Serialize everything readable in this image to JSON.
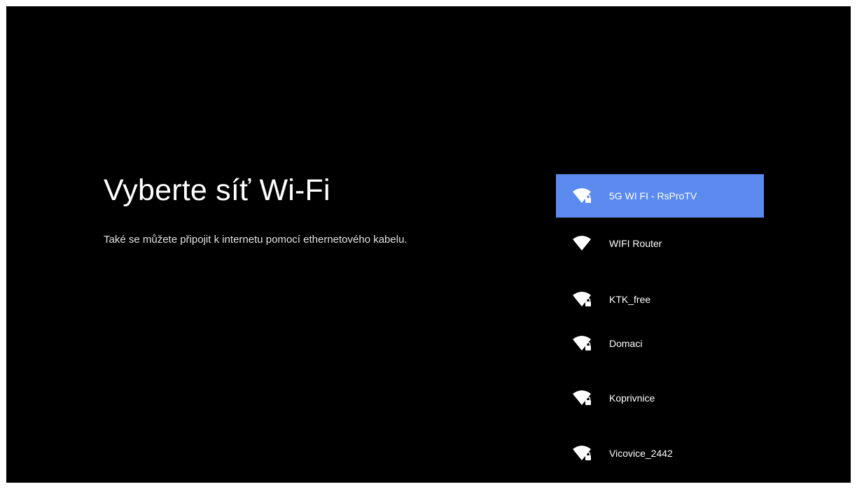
{
  "page": {
    "title": "Vyberte síť Wi-Fi",
    "subtitle": "Také se můžete připojit k internetu pomocí ethernetového kabelu."
  },
  "networks": [
    {
      "name": "5G WI FI - RsProTV",
      "selected": true,
      "secured": true,
      "icon": "wifi-lock-icon"
    },
    {
      "name": "WIFI Router",
      "selected": false,
      "secured": false,
      "icon": "wifi-icon"
    },
    {
      "name": "KTK_free",
      "selected": false,
      "secured": true,
      "icon": "wifi-lock-icon"
    },
    {
      "name": "Domaci",
      "selected": false,
      "secured": true,
      "icon": "wifi-lock-icon"
    },
    {
      "name": "Koprivnice",
      "selected": false,
      "secured": true,
      "icon": "wifi-lock-icon"
    },
    {
      "name": "Vicovice_2442",
      "selected": false,
      "secured": true,
      "icon": "wifi-lock-icon"
    }
  ],
  "colors": {
    "background": "#000000",
    "selected": "#5b8bef",
    "text": "#ffffff"
  }
}
